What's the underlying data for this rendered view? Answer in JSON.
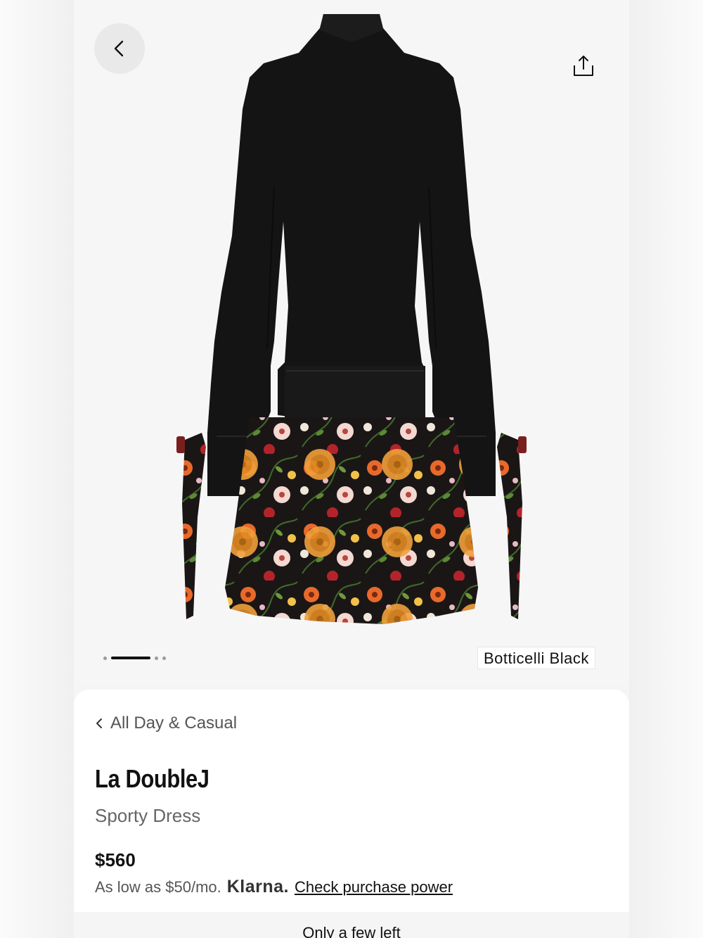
{
  "hero": {
    "color_name": "Botticelli Black",
    "carousel": {
      "total": 4,
      "active_index": 1
    }
  },
  "icons": {
    "back": "chevron-left-icon",
    "share": "share-upload-icon",
    "crumb": "chevron-left-small-icon"
  },
  "product": {
    "breadcrumb": "All Day & Casual",
    "brand": "La DoubleJ",
    "name": "Sporty Dress",
    "price": "$560"
  },
  "financing": {
    "prefix": "As low as $50/mo.",
    "provider": "Klarna.",
    "link": "Check purchase power"
  },
  "stock": {
    "message": "Only a few left"
  },
  "colors": {
    "accent": "#111111",
    "muted": "#666666"
  }
}
